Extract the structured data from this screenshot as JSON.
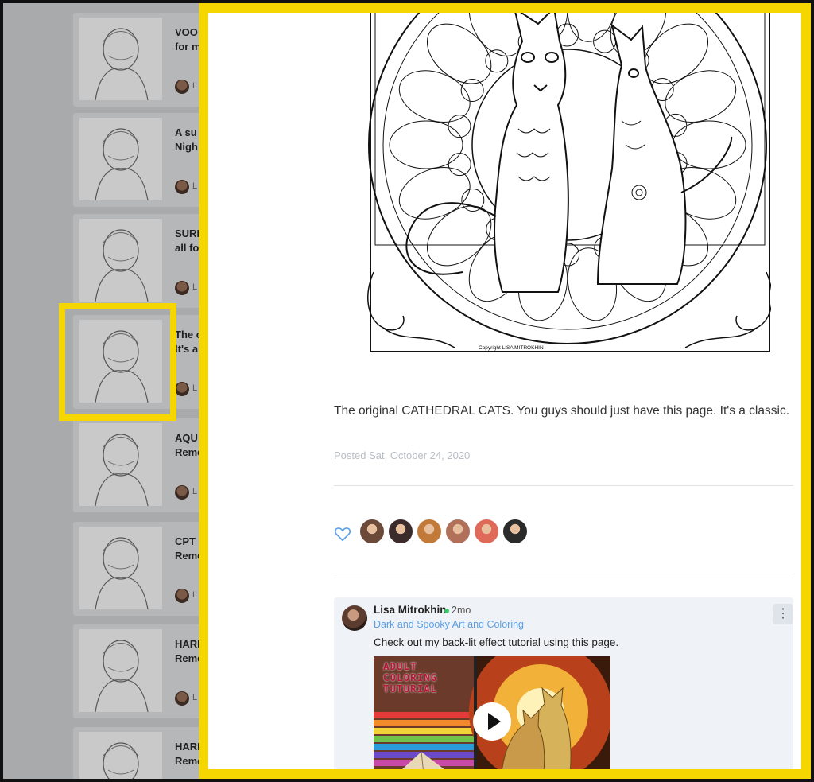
{
  "sidebar": {
    "cards": [
      {
        "title_line1": "VOO",
        "title_line2": "for m",
        "author_initial": "L"
      },
      {
        "title_line1": "A su",
        "title_line2": "Nigh",
        "author_initial": "L"
      },
      {
        "title_line1": "SURF",
        "title_line2": "all fo",
        "author_initial": "L"
      },
      {
        "title_line1": "The c",
        "title_line2": "It's a",
        "author_initial": "L"
      },
      {
        "title_line1": "AQU",
        "title_line2": "Reme",
        "author_initial": "L"
      },
      {
        "title_line1": "CPT I",
        "title_line2": "Reme",
        "author_initial": "L"
      },
      {
        "title_line1": "HARI",
        "title_line2": "Reme",
        "author_initial": "L"
      },
      {
        "title_line1": "HARI",
        "title_line2": "Reme",
        "author_initial": "L"
      }
    ]
  },
  "post": {
    "image_copyright": "Copyright LISA MITROKHIN",
    "caption": "The original CATHEDRAL CATS. You guys should just have this page. It's a classic.",
    "posted": "Posted Sat, October 24, 2020"
  },
  "likes": {
    "icon": "heart-icon",
    "avatar_colors": [
      "#6b4a3a",
      "#3b2b2b",
      "#c27a3a",
      "#b0705a",
      "#e06a5a",
      "#2b2b2b"
    ]
  },
  "comment": {
    "author": "Lisa Mitrokhin",
    "time": "2mo",
    "group": "Dark and Spooky Art and Coloring",
    "text": "Check out my back-lit effect tutorial using this page.",
    "more_icon": "⋮",
    "video_title_lines": [
      "ADULT",
      "COLORING",
      "TUTURIAL"
    ]
  },
  "colors": {
    "highlight": "#f5d600",
    "online_dot": "#39c46a",
    "link": "#5aa0e6"
  }
}
